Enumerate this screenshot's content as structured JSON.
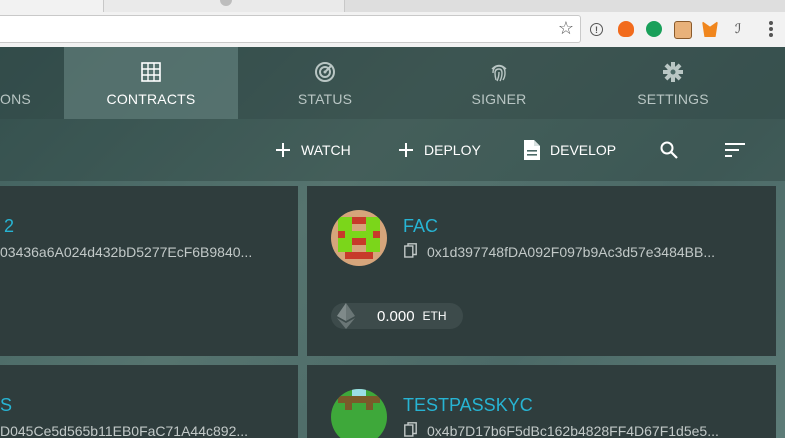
{
  "nav": {
    "items": [
      {
        "label": "ONS"
      },
      {
        "label": "CONTRACTS"
      },
      {
        "label": "STATUS"
      },
      {
        "label": "SIGNER"
      },
      {
        "label": "SETTINGS"
      }
    ]
  },
  "actions": {
    "watch": "WATCH",
    "deploy": "DEPLOY",
    "develop": "DEVELOP"
  },
  "contracts": [
    {
      "name": "2",
      "address": "03436a6A024d432bD5277EcF6B9840..."
    },
    {
      "name": "FAC",
      "address": "0x1d397748fDA092F097b9Ac3d57e3484BB...",
      "balance": "0.000",
      "unit": "ETH"
    },
    {
      "name": "S",
      "address": "D045Ce5d565b11EB0FaC71A44c892..."
    },
    {
      "name": "TESTPASSKYC",
      "address": "0x4b7D17b6F5dBc162b4828FF4D67F1d5e5..."
    }
  ],
  "colors": {
    "accent": "#27b4d3",
    "card": "#2f3d3d"
  }
}
